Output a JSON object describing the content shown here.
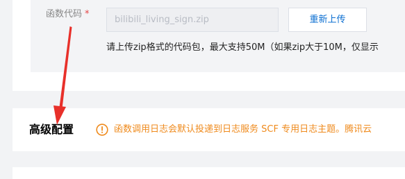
{
  "function_code": {
    "label": "函数代码",
    "required_mark": "*",
    "file_name": "bilibili_living_sign.zip",
    "reupload_label": "重新上传",
    "hint": "请上传zip格式的代码包，最大支持50M（如果zip大于10M，仅显示"
  },
  "advanced_config": {
    "title": "高级配置",
    "notice_icon": "warning-circle-icon",
    "notice": "函数调用日志会默认投递到日志服务 SCF 专用日志主题。腾讯云"
  },
  "colors": {
    "accent_blue": "#0a6ed1",
    "warning_orange": "#ef8a1c",
    "required_red": "#e54545",
    "annotation_red": "#e8302a"
  }
}
